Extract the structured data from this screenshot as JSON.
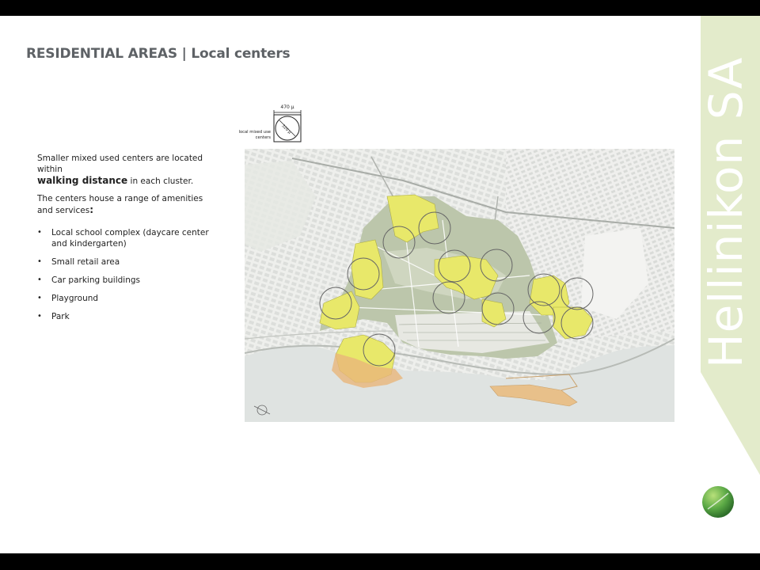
{
  "slide": {
    "title": "RESIDENTIAL AREAS | Local centers",
    "intro_line1": "Smaller mixed used centers are located within",
    "intro_bold": "walking distance",
    "intro_line2": " in each cluster.",
    "amenities_intro": "The centers house a range of amenities and services",
    "amenities_colon": ":",
    "bullets": [
      "Local school complex (daycare center and kindergarten)",
      "Small retail area",
      "Car parking buildings",
      "Playground",
      "Park"
    ]
  },
  "legend": {
    "width_label": "470 μ",
    "diameter_label": "320 μ",
    "caption_line1": "local mixed use",
    "caption_line2": "centers"
  },
  "brand": {
    "name": "Hellinikon SA",
    "band_color": "#e3ebcb",
    "text_color": "#ffffff",
    "logo_color": "#5aa845"
  },
  "map": {
    "water_color": "#dfe3e1",
    "park_color": "#b9c3aa",
    "residential_color": "#e8e86a",
    "coast_color": "#e8b57a"
  }
}
